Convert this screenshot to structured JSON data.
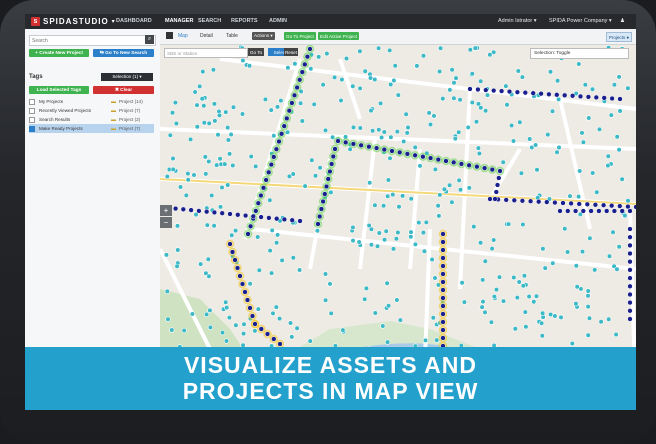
{
  "nav": {
    "brand": "SPIDASTUDIO",
    "tabs": [
      "DASHBOARD",
      "MANAGER",
      "SEARCH",
      "REPORTS",
      "ADMIN"
    ],
    "active_tab": "MANAGER",
    "user": "Admin Istrator ▾",
    "company": "SPIDA Power Company ▾",
    "user_icon": "user-icon"
  },
  "sidebar": {
    "search_placeholder": "Search",
    "create_label": "+ Create New Project",
    "go_label": "⇆ Go To New Search",
    "tags_title": "Tags",
    "selection_label": "Selection (1) ▾",
    "load_label": "Load Selected Tags",
    "clear_label": "✖ Clear",
    "rows": [
      {
        "label": "My Projects",
        "count": "Project (14)"
      },
      {
        "label": "Recently Viewed Projects",
        "count": "Project (7)"
      },
      {
        "label": "Search Results",
        "count": "Project (2)"
      },
      {
        "label": "Make Ready Projects",
        "count": "Project (7)"
      }
    ]
  },
  "toolbar": {
    "map": "Map",
    "detail": "Detail",
    "table": "Table",
    "actions": "Actions ▾",
    "goto_project": "Go To Project",
    "edit_project": "Edit Active Project",
    "projects_toggle": "Projects ●"
  },
  "map": {
    "search_placeholder": "SBS or Station",
    "go": "Go To",
    "select_label": "Select",
    "reset_label": "Reset",
    "selection_dropdown": "Selection: Toggle",
    "zoom_in": "+",
    "zoom_out": "−"
  },
  "banner": {
    "line1": "VISUALIZE ASSETS AND",
    "line2": "PROJECTS IN MAP VIEW"
  },
  "colors": {
    "nav_bg": "#27292c",
    "accent_green": "#3fb34f",
    "accent_blue": "#2c7fc9",
    "accent_red": "#d23131",
    "banner": "#24a0cc",
    "pole_marker": "#3cb9c6",
    "project_highlight": "#5ed14a",
    "route_dark": "#1a1f8f"
  }
}
